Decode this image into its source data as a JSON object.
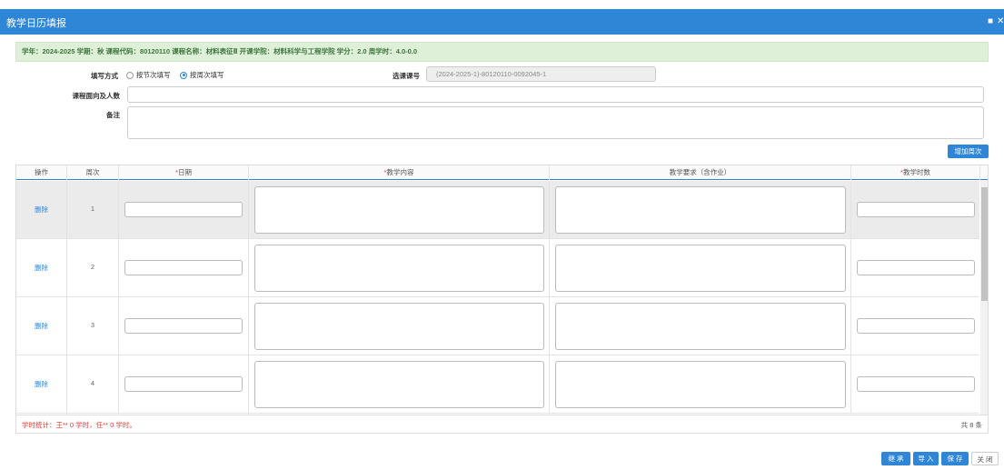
{
  "window": {
    "title": "教学日历填报",
    "controls": [
      "■",
      "✕"
    ]
  },
  "info": {
    "text": "学年：2024-2025   学期：秋   课程代码：80120110   课程名称：材料表征Ⅱ   开课学院：材料科学与工程学院   学分：2.0   周学时：4.0-0.0"
  },
  "form": {
    "fill_mode_label": "填写方式",
    "fill_mode_options": [
      "按节次填写",
      "按周次填写"
    ],
    "selected_mode": "按周次填写",
    "course_no_label": "选课课号",
    "course_no_value": "(2024-2025-1)-80120110-0092045-1",
    "audience_label": "课程面向及人数",
    "note_label": "备注",
    "add_week_button": "增加周次"
  },
  "table": {
    "headers": [
      "操作",
      "周次",
      "日期",
      "教学内容",
      "教学要求（含作业）",
      "教学时数"
    ],
    "required_marker": "*",
    "rows": [
      {
        "action": "删除",
        "week": "1"
      },
      {
        "action": "删除",
        "week": "2"
      },
      {
        "action": "删除",
        "week": "3"
      },
      {
        "action": "删除",
        "week": "4"
      }
    ]
  },
  "footer": {
    "stats": "学时统计：王** 0 学时，任** 0 学时。",
    "total": "共 8 条"
  },
  "actions": {
    "import_record": "继 承",
    "import": "导 入",
    "save": "保 存",
    "close": "关 闭"
  },
  "colors": {
    "accent": "#2f86d6",
    "info_bg": "#dff0d8",
    "info_text": "#3c763d",
    "required": "#e53935"
  }
}
